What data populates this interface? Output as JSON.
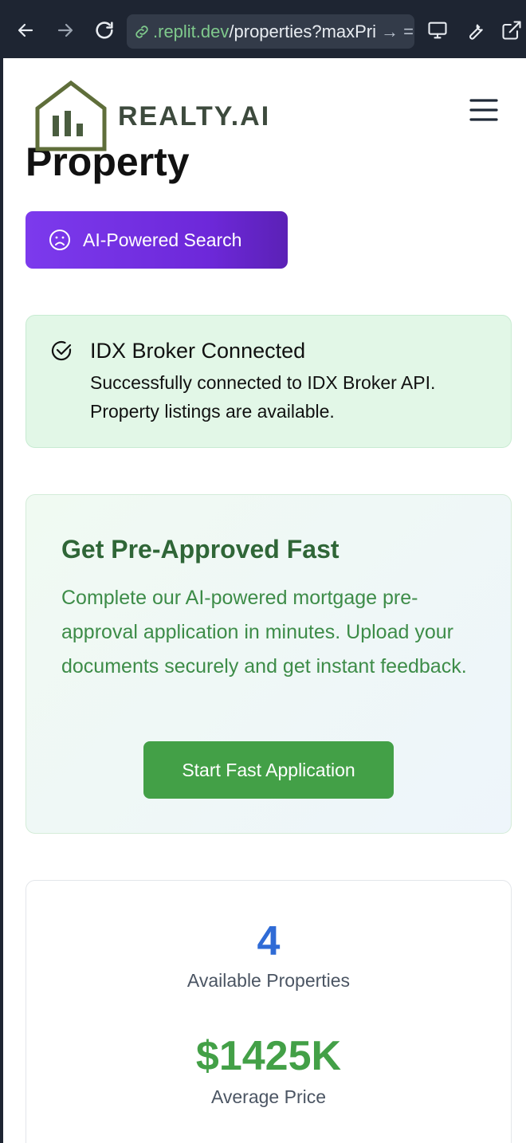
{
  "browser": {
    "url_domain": ".replit.dev",
    "url_path": "/properties?maxPri",
    "url_suffix": "→ ="
  },
  "page": {
    "hero_fragment_1": "Property",
    "brand_name": "REALTY.AI",
    "ai_search_label": "AI-Powered Search",
    "alert": {
      "title": "IDX Broker Connected",
      "body": "Successfully connected to IDX Broker API. Property listings are available."
    },
    "promo": {
      "title": "Get Pre-Approved Fast",
      "text": "Complete our AI-powered mortgage pre-approval application in minutes. Upload your documents securely and get instant feedback.",
      "button_label": "Start Fast Application"
    },
    "stats": {
      "count": "4",
      "count_label": "Available Properties",
      "avg_price": "$1425K",
      "avg_price_label": "Average Price"
    }
  },
  "colors": {
    "accent_purple": "#7c3aed",
    "success_green": "#43a047",
    "stat_blue": "#2f6bd6",
    "brand_olive": "#5f6e3a"
  },
  "icons": [
    "back-arrow-icon",
    "forward-arrow-icon",
    "reload-icon",
    "link-icon",
    "monitor-icon",
    "wrench-icon",
    "external-link-icon",
    "house-chart-logo-icon",
    "hamburger-menu-icon",
    "sad-face-icon",
    "check-circle-icon"
  ]
}
